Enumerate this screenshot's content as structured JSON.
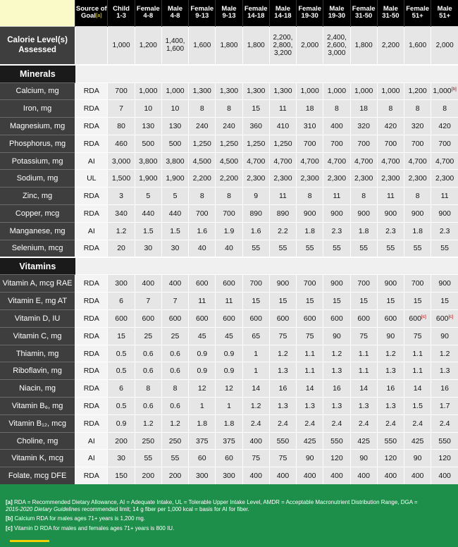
{
  "header": {
    "source_label": "Source of Goal",
    "source_sup": "[a]",
    "groups": [
      {
        "line1": "Child",
        "line2": "1-3"
      },
      {
        "line1": "Female",
        "line2": "4-8"
      },
      {
        "line1": "Male",
        "line2": "4-8"
      },
      {
        "line1": "Female",
        "line2": "9-13"
      },
      {
        "line1": "Male",
        "line2": "9-13"
      },
      {
        "line1": "Female",
        "line2": "14-18"
      },
      {
        "line1": "Male",
        "line2": "14-18"
      },
      {
        "line1": "Female",
        "line2": "19-30"
      },
      {
        "line1": "Male",
        "line2": "19-30"
      },
      {
        "line1": "Female",
        "line2": "31-50"
      },
      {
        "line1": "Male",
        "line2": "31-50"
      },
      {
        "line1": "Female",
        "line2": "51+"
      },
      {
        "line1": "Male",
        "line2": "51+"
      }
    ]
  },
  "calorie": {
    "label": "Calorie Level(s) Assessed",
    "values": [
      "1,000",
      "1,200",
      "1,400, 1,600",
      "1,600",
      "1,800",
      "1,800",
      "2,200, 2,800, 3,200",
      "2,000",
      "2,400, 2,600, 3,000",
      "1,800",
      "2,200",
      "1,600",
      "2,000"
    ]
  },
  "sections": [
    {
      "title": "Minerals",
      "rows": [
        {
          "name": "Calcium, mg",
          "source": "RDA",
          "values": [
            "700",
            "1,000",
            "1,000",
            "1,300",
            "1,300",
            "1,300",
            "1,300",
            "1,000",
            "1,000",
            "1,000",
            "1,000",
            "1,200",
            "1,000"
          ],
          "sups": {
            "12": "[b]"
          }
        },
        {
          "name": "Iron, mg",
          "source": "RDA",
          "values": [
            "7",
            "10",
            "10",
            "8",
            "8",
            "15",
            "11",
            "18",
            "8",
            "18",
            "8",
            "8",
            "8"
          ]
        },
        {
          "name": "Magnesium, mg",
          "source": "RDA",
          "values": [
            "80",
            "130",
            "130",
            "240",
            "240",
            "360",
            "410",
            "310",
            "400",
            "320",
            "420",
            "320",
            "420"
          ]
        },
        {
          "name": "Phosphorus, mg",
          "source": "RDA",
          "values": [
            "460",
            "500",
            "500",
            "1,250",
            "1,250",
            "1,250",
            "1,250",
            "700",
            "700",
            "700",
            "700",
            "700",
            "700"
          ]
        },
        {
          "name": "Potassium, mg",
          "source": "AI",
          "values": [
            "3,000",
            "3,800",
            "3,800",
            "4,500",
            "4,500",
            "4,700",
            "4,700",
            "4,700",
            "4,700",
            "4,700",
            "4,700",
            "4,700",
            "4,700"
          ]
        },
        {
          "name": "Sodium, mg",
          "source": "UL",
          "values": [
            "1,500",
            "1,900",
            "1,900",
            "2,200",
            "2,200",
            "2,300",
            "2,300",
            "2,300",
            "2,300",
            "2,300",
            "2,300",
            "2,300",
            "2,300"
          ]
        },
        {
          "name": "Zinc, mg",
          "source": "RDA",
          "values": [
            "3",
            "5",
            "5",
            "8",
            "8",
            "9",
            "11",
            "8",
            "11",
            "8",
            "11",
            "8",
            "11"
          ]
        },
        {
          "name": "Copper, mcg",
          "source": "RDA",
          "values": [
            "340",
            "440",
            "440",
            "700",
            "700",
            "890",
            "890",
            "900",
            "900",
            "900",
            "900",
            "900",
            "900"
          ]
        },
        {
          "name": "Manganese, mg",
          "source": "AI",
          "values": [
            "1.2",
            "1.5",
            "1.5",
            "1.6",
            "1.9",
            "1.6",
            "2.2",
            "1.8",
            "2.3",
            "1.8",
            "2.3",
            "1.8",
            "2.3"
          ]
        },
        {
          "name": "Selenium, mcg",
          "source": "RDA",
          "values": [
            "20",
            "30",
            "30",
            "40",
            "40",
            "55",
            "55",
            "55",
            "55",
            "55",
            "55",
            "55",
            "55"
          ]
        }
      ]
    },
    {
      "title": "Vitamins",
      "rows": [
        {
          "name": "Vitamin A, mcg RAE",
          "source": "RDA",
          "values": [
            "300",
            "400",
            "400",
            "600",
            "600",
            "700",
            "900",
            "700",
            "900",
            "700",
            "900",
            "700",
            "900"
          ]
        },
        {
          "name": "Vitamin E, mg AT",
          "source": "RDA",
          "values": [
            "6",
            "7",
            "7",
            "11",
            "11",
            "15",
            "15",
            "15",
            "15",
            "15",
            "15",
            "15",
            "15"
          ]
        },
        {
          "name": "Vitamin D, IU",
          "source": "RDA",
          "values": [
            "600",
            "600",
            "600",
            "600",
            "600",
            "600",
            "600",
            "600",
            "600",
            "600",
            "600",
            "600",
            "600"
          ],
          "sups": {
            "11": "[c]",
            "12": "[c]"
          }
        },
        {
          "name": "Vitamin C, mg",
          "source": "RDA",
          "values": [
            "15",
            "25",
            "25",
            "45",
            "45",
            "65",
            "75",
            "75",
            "90",
            "75",
            "90",
            "75",
            "90"
          ]
        },
        {
          "name": "Thiamin, mg",
          "source": "RDA",
          "values": [
            "0.5",
            "0.6",
            "0.6",
            "0.9",
            "0.9",
            "1",
            "1.2",
            "1.1",
            "1.2",
            "1.1",
            "1.2",
            "1.1",
            "1.2"
          ]
        },
        {
          "name": "Riboflavin, mg",
          "source": "RDA",
          "values": [
            "0.5",
            "0.6",
            "0.6",
            "0.9",
            "0.9",
            "1",
            "1.3",
            "1.1",
            "1.3",
            "1.1",
            "1.3",
            "1.1",
            "1.3"
          ]
        },
        {
          "name": "Niacin, mg",
          "source": "RDA",
          "values": [
            "6",
            "8",
            "8",
            "12",
            "12",
            "14",
            "16",
            "14",
            "16",
            "14",
            "16",
            "14",
            "16"
          ]
        },
        {
          "name": "Vitamin B₆, mg",
          "source": "RDA",
          "values": [
            "0.5",
            "0.6",
            "0.6",
            "1",
            "1",
            "1.2",
            "1.3",
            "1.3",
            "1.3",
            "1.3",
            "1.3",
            "1.5",
            "1.7"
          ]
        },
        {
          "name": "Vitamin B₁₂, mcg",
          "source": "RDA",
          "values": [
            "0.9",
            "1.2",
            "1.2",
            "1.8",
            "1.8",
            "2.4",
            "2.4",
            "2.4",
            "2.4",
            "2.4",
            "2.4",
            "2.4",
            "2.4"
          ]
        },
        {
          "name": "Choline, mg",
          "source": "AI",
          "values": [
            "200",
            "250",
            "250",
            "375",
            "375",
            "400",
            "550",
            "425",
            "550",
            "425",
            "550",
            "425",
            "550"
          ]
        },
        {
          "name": "Vitamin K, mcg",
          "source": "AI",
          "values": [
            "30",
            "55",
            "55",
            "60",
            "60",
            "75",
            "75",
            "90",
            "120",
            "90",
            "120",
            "90",
            "120"
          ]
        },
        {
          "name": "Folate, mcg DFE",
          "source": "RDA",
          "values": [
            "150",
            "200",
            "200",
            "300",
            "300",
            "400",
            "400",
            "400",
            "400",
            "400",
            "400",
            "400",
            "400"
          ]
        }
      ]
    }
  ],
  "footnotes": {
    "a_label": "[a]",
    "a_text": "RDA = Recommended Dietary Allowance, AI = Adequate Intake, UL = Tolerable Upper Intake Level, AMDR = Acceptable Macronutrient Distribution Range, DGA =",
    "a_ital": "2015-2020 Dietary Guidelines",
    "a_text2": "recommended limit; 14 g fiber per 1,000 kcal = basis for AI for fiber.",
    "b_label": "[b]",
    "b_text": "Calcium RDA for males ages 71+ years is 1,200 mg.",
    "c_label": "[c]",
    "c_text": "Vitamin D RDA for males and females ages 71+ years is 800 IU."
  },
  "colors": {
    "header_bg": "#000000",
    "row_label_bg": "#3e3e3e",
    "cell_bg": "#e6e6e6",
    "footer_bg": "#1d8f4a",
    "footnote_mark": "#b00000",
    "accent_yellow": "#f0d000"
  }
}
